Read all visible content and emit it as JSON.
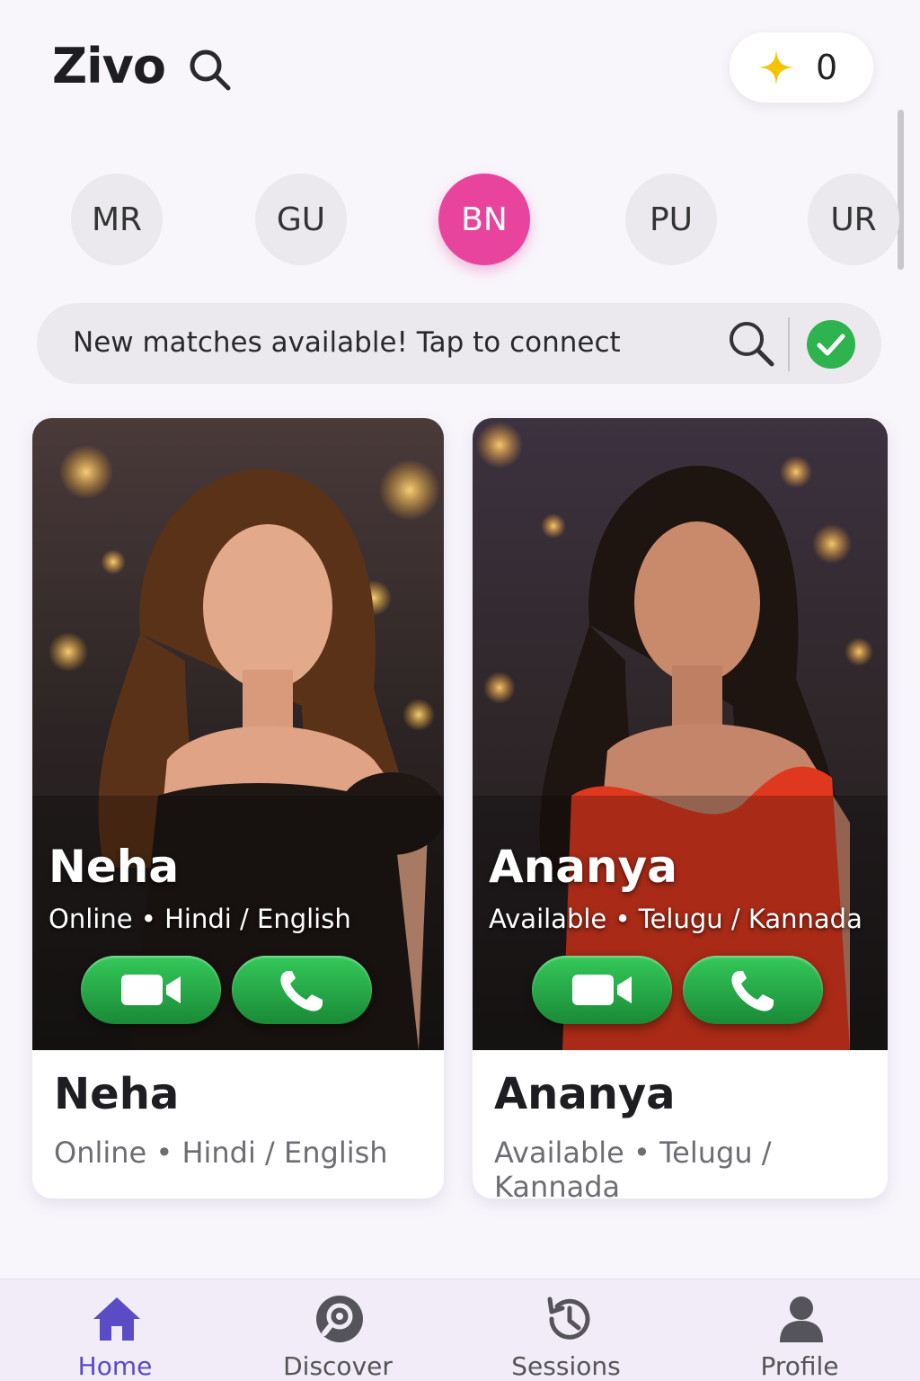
{
  "header": {
    "app_title": "Zivo",
    "coin_count": "0",
    "icons": [
      "search-icon",
      "sparkle-icon"
    ]
  },
  "languages": [
    {
      "label": "MR",
      "active": false
    },
    {
      "label": "GU",
      "active": false
    },
    {
      "label": "BN",
      "active": true
    },
    {
      "label": "PU",
      "active": false
    },
    {
      "label": "UR",
      "active": false
    }
  ],
  "notice": {
    "text": "New matches available! Tap to connect",
    "icons": [
      "search-icon",
      "check-circle-icon"
    ]
  },
  "profiles": [
    {
      "name": "Neha",
      "status": "Online",
      "languages": "Hindi / English",
      "meta": "Online • Hindi / English",
      "outfit_color": "#1f1714"
    },
    {
      "name": "Ananya",
      "status": "Available",
      "languages": "Telugu / Kannada",
      "meta": "Available • Telugu / Kannada",
      "outfit_color": "#e0381f"
    }
  ],
  "bottom_nav": [
    {
      "label": "Home",
      "icon": "home-icon",
      "active": true
    },
    {
      "label": "Discover",
      "icon": "discover-icon",
      "active": false
    },
    {
      "label": "Sessions",
      "icon": "history-icon",
      "active": false
    },
    {
      "label": "Profile",
      "icon": "profile-icon",
      "active": false
    }
  ],
  "colors": {
    "accent_pink": "#e8449e",
    "call_green": "#22a044",
    "nav_active": "#5b4bc4",
    "coin_yellow": "#f5c400"
  }
}
